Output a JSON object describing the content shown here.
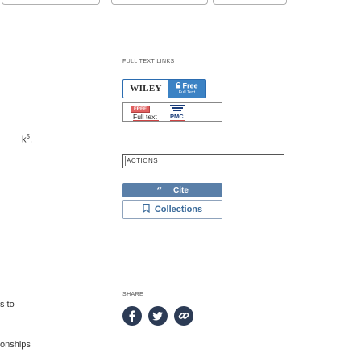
{
  "left_text": {
    "line1": "k",
    "line1_sup": "5",
    "line1_suffix": ",",
    "line2": "s to",
    "line3": "onships"
  },
  "full_text_links": {
    "title": "FULL TEXT LINKS",
    "wiley": {
      "word": "WILEY",
      "badge_top": "Free",
      "badge_bottom": "Full Text",
      "lock_icon": "open-lock-icon"
    },
    "pmc": {
      "badge": "FREE",
      "label": "Full text",
      "logo_text": "PMC"
    }
  },
  "actions": {
    "title": "ACTIONS",
    "cite_label": "Cite",
    "cite_icon": "quote-icon",
    "collections_label": "Collections",
    "collections_icon": "bookmark-icon",
    "accent": "#5a7fa8"
  },
  "share": {
    "title": "SHARE",
    "icons": [
      "facebook-icon",
      "twitter-icon",
      "permalink-icon"
    ],
    "color": "#2c3b55"
  }
}
